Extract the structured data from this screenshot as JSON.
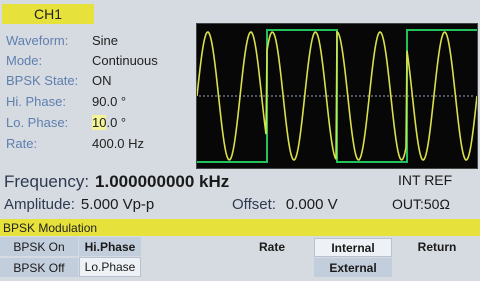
{
  "channel": {
    "label": "CH1"
  },
  "params": [
    {
      "label": "Waveform:",
      "value": "Sine"
    },
    {
      "label": "Mode:",
      "value": "Continuous"
    },
    {
      "label": "BPSK State:",
      "value": "ON"
    },
    {
      "label": "Hi. Phase:",
      "value": "90.0 °"
    },
    {
      "label": "Lo. Phase:",
      "value_edit": "10",
      "value_rest": ".0 °"
    },
    {
      "label": "Rate:",
      "value": "400.0 Hz"
    }
  ],
  "frequency": {
    "label": "Frequency:",
    "value": "1.000000000 kHz"
  },
  "amplitude": {
    "label": "Amplitude:",
    "value": "5.000 Vp-p"
  },
  "offset": {
    "label": "Offset:",
    "value": "0.000 V"
  },
  "reference": "INT REF",
  "output": "OUT:50Ω",
  "menu": {
    "title": "BPSK Modulation",
    "bpsk_on": "BPSK On",
    "bpsk_off": "BPSK Off",
    "hi_phase": "Hi.Phase",
    "lo_phase": "Lo.Phase",
    "rate": "Rate",
    "internal": "Internal",
    "external": "External",
    "return": "Return"
  },
  "colors": {
    "accent": "#e7e23b",
    "background": "#d6dbe2",
    "label": "#5f7fae",
    "trace_sine": "#d8e04a",
    "trace_square": "#22c25a"
  },
  "waveform": {
    "sine_cycles": 6.5,
    "square_cycles": 2,
    "phase_shift_deg": 180
  }
}
